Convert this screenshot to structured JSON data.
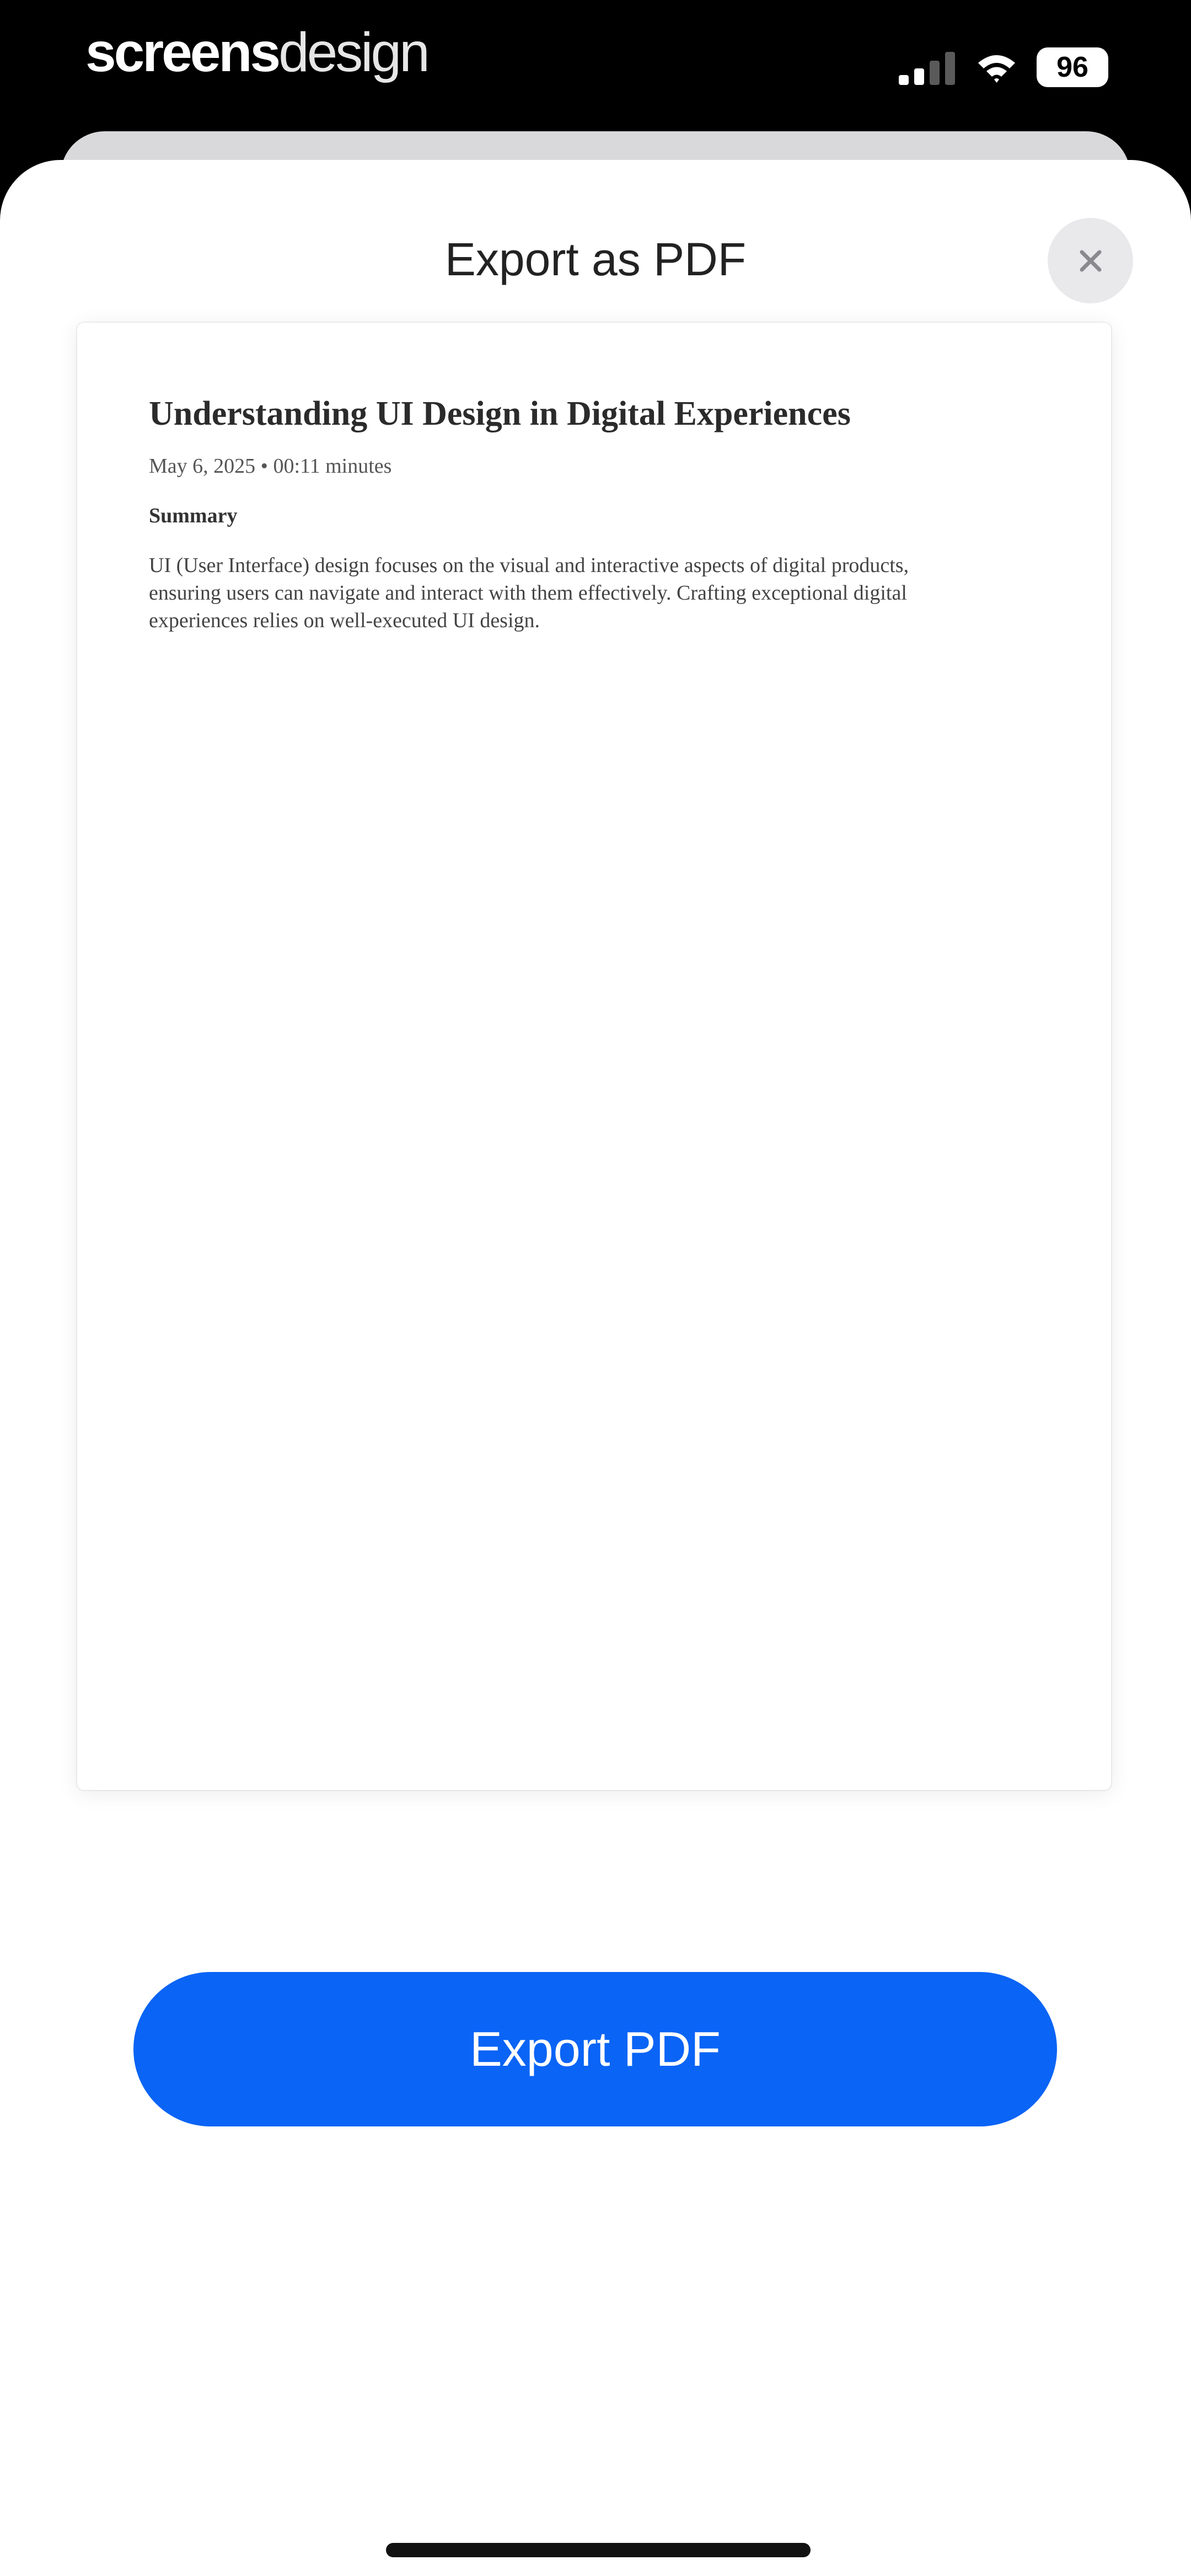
{
  "status_bar": {
    "brand_bold": "screens",
    "brand_light": "design",
    "battery": "96",
    "icons": [
      "signal-icon",
      "wifi-icon",
      "battery-icon"
    ]
  },
  "sheet": {
    "title": "Export as PDF",
    "close_icon": "close-icon"
  },
  "preview": {
    "title": "Understanding UI Design in Digital Experiences",
    "meta": "May 6, 2025 • 00:11 minutes",
    "section_heading": "Summary",
    "body": "UI (User Interface) design focuses on the visual and interactive aspects of digital products, ensuring users can navigate and interact with them effectively. Crafting exceptional digital experiences relies on well-executed UI design."
  },
  "actions": {
    "export_label": "Export PDF"
  },
  "colors": {
    "accent": "#0a64f5",
    "sheet_background": "#ffffff",
    "status_bar_background": "#000000"
  }
}
